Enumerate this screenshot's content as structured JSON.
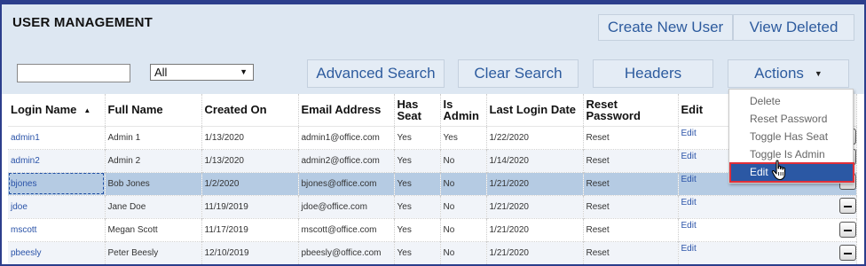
{
  "header": {
    "title": "USER MANAGEMENT",
    "create_label": "Create New User",
    "view_deleted_label": "View Deleted"
  },
  "toolbar": {
    "search_value": "",
    "filter_selected": "All",
    "advanced_search_label": "Advanced Search",
    "clear_search_label": "Clear Search",
    "headers_label": "Headers",
    "actions_label": "Actions"
  },
  "table": {
    "columns": [
      "Login Name",
      "Full Name",
      "Created On",
      "Email Address",
      "Has Seat",
      "Is Admin",
      "Last Login Date",
      "Reset Password",
      "Edit"
    ],
    "rows": [
      {
        "login": "admin1",
        "full_name": "Admin 1",
        "created": "1/13/2020",
        "email": "admin1@office.com",
        "has_seat": "Yes",
        "is_admin": "Yes",
        "last_login": "1/22/2020",
        "reset": "Reset",
        "edit": "Edit"
      },
      {
        "login": "admin2",
        "full_name": "Admin 2",
        "created": "1/13/2020",
        "email": "admin2@office.com",
        "has_seat": "Yes",
        "is_admin": "No",
        "last_login": "1/14/2020",
        "reset": "Reset",
        "edit": "Edit"
      },
      {
        "login": "bjones",
        "full_name": "Bob Jones",
        "created": "1/2/2020",
        "email": "bjones@office.com",
        "has_seat": "Yes",
        "is_admin": "No",
        "last_login": "1/21/2020",
        "reset": "Reset",
        "edit": "Edit"
      },
      {
        "login": "jdoe",
        "full_name": "Jane Doe",
        "created": "11/19/2019",
        "email": "jdoe@office.com",
        "has_seat": "Yes",
        "is_admin": "No",
        "last_login": "1/21/2020",
        "reset": "Reset",
        "edit": "Edit"
      },
      {
        "login": "mscott",
        "full_name": "Megan Scott",
        "created": "11/17/2019",
        "email": "mscott@office.com",
        "has_seat": "Yes",
        "is_admin": "No",
        "last_login": "1/21/2020",
        "reset": "Reset",
        "edit": "Edit"
      },
      {
        "login": "pbeesly",
        "full_name": "Peter Beesly",
        "created": "12/10/2019",
        "email": "pbeesly@office.com",
        "has_seat": "Yes",
        "is_admin": "No",
        "last_login": "1/21/2020",
        "reset": "Reset",
        "edit": "Edit"
      }
    ]
  },
  "actions_menu": {
    "items": [
      "Delete",
      "Reset Password",
      "Toggle Has Seat",
      "Toggle Is Admin",
      "Edit"
    ],
    "highlighted": "Edit"
  },
  "colors": {
    "frame": "#2c3e8c",
    "header_bg": "#dde7f2",
    "selected_row": "#b5cbe3",
    "menu_highlight": "#2b58a4",
    "highlight_border": "#e0303a",
    "link": "#2a53a8"
  },
  "icons": {
    "sort": "sort-ascending-icon",
    "dropdown": "caret-down-icon",
    "row_action": "minus-icon",
    "cursor": "hand-pointer-icon"
  }
}
